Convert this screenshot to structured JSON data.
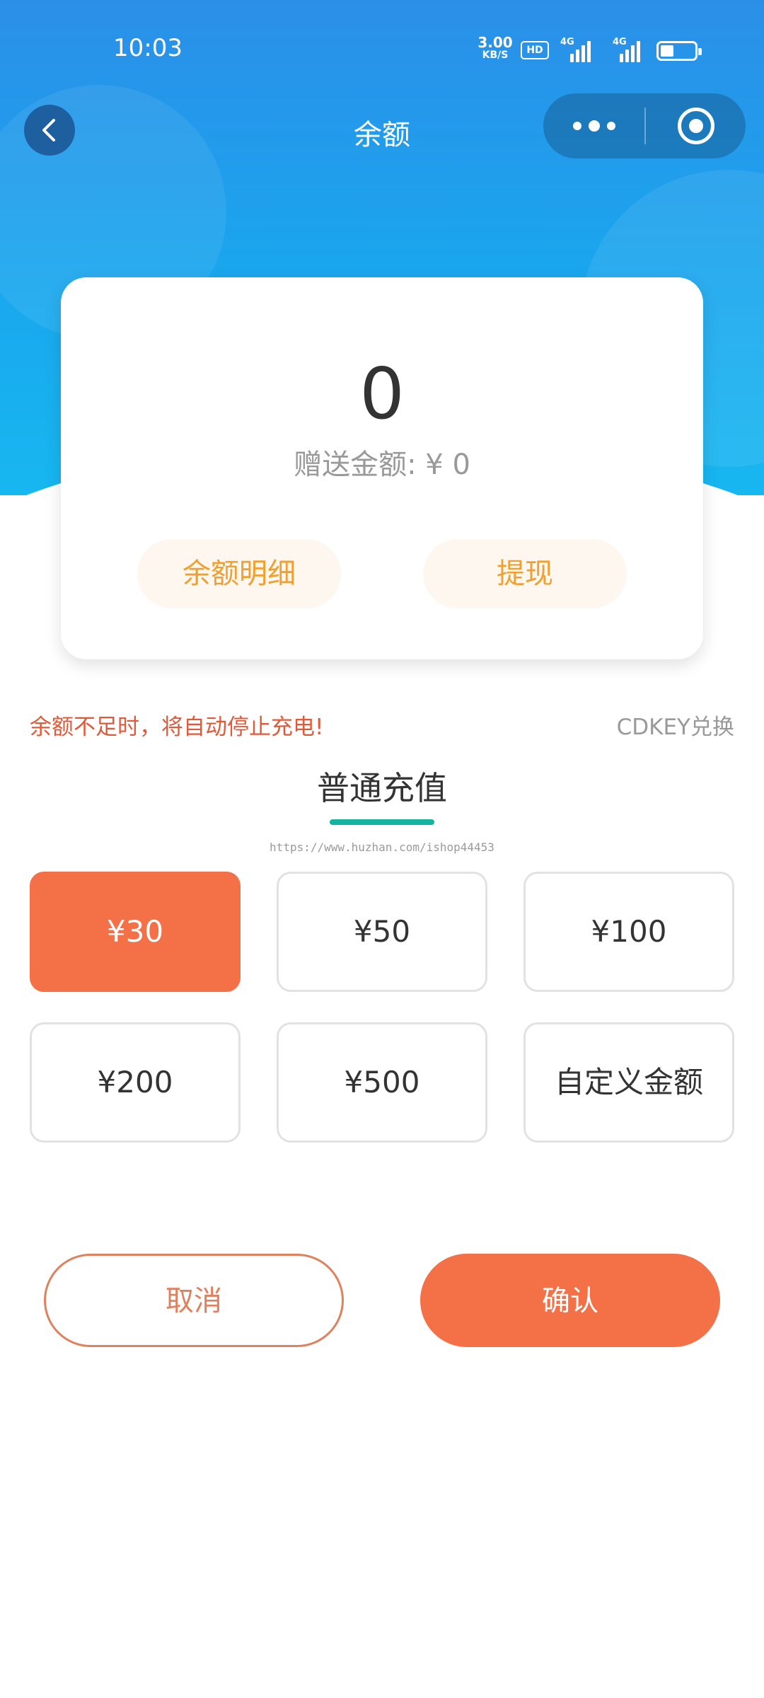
{
  "status_bar": {
    "time": "10:03",
    "net_speed": "3.00",
    "net_speed_unit": "KB/S",
    "hd_label": "HD",
    "signal_1": "4G",
    "signal_2": "4G",
    "battery_level_percent": 40
  },
  "nav": {
    "title": "余额",
    "back_icon": "chevron-left-icon",
    "more_icon": "more-dots-icon",
    "close_icon": "target-close-icon"
  },
  "balance_card": {
    "balance": "0",
    "gift_amount": "赠送金额: ¥ 0",
    "detail_button": "余额明细",
    "withdraw_button": "提现"
  },
  "notice": {
    "text": "余额不足时，将自动停止充电!",
    "cdkey_link": "CDKEY兑换"
  },
  "recharge": {
    "tab_title": "普通充值",
    "watermark": "https://www.huzhan.com/ishop44453",
    "options": [
      {
        "label": "¥30",
        "selected": true
      },
      {
        "label": "¥50",
        "selected": false
      },
      {
        "label": "¥100",
        "selected": false
      },
      {
        "label": "¥200",
        "selected": false
      },
      {
        "label": "¥500",
        "selected": false
      },
      {
        "label": "自定义金额",
        "selected": false
      }
    ]
  },
  "actions": {
    "cancel": "取消",
    "confirm": "确认"
  },
  "colors": {
    "header_blue": "#1aa6ee",
    "accent_orange": "#f47148",
    "warning_red": "#e05a3a",
    "tab_teal": "#14b5a0",
    "button_text_gold": "#f0a030"
  }
}
